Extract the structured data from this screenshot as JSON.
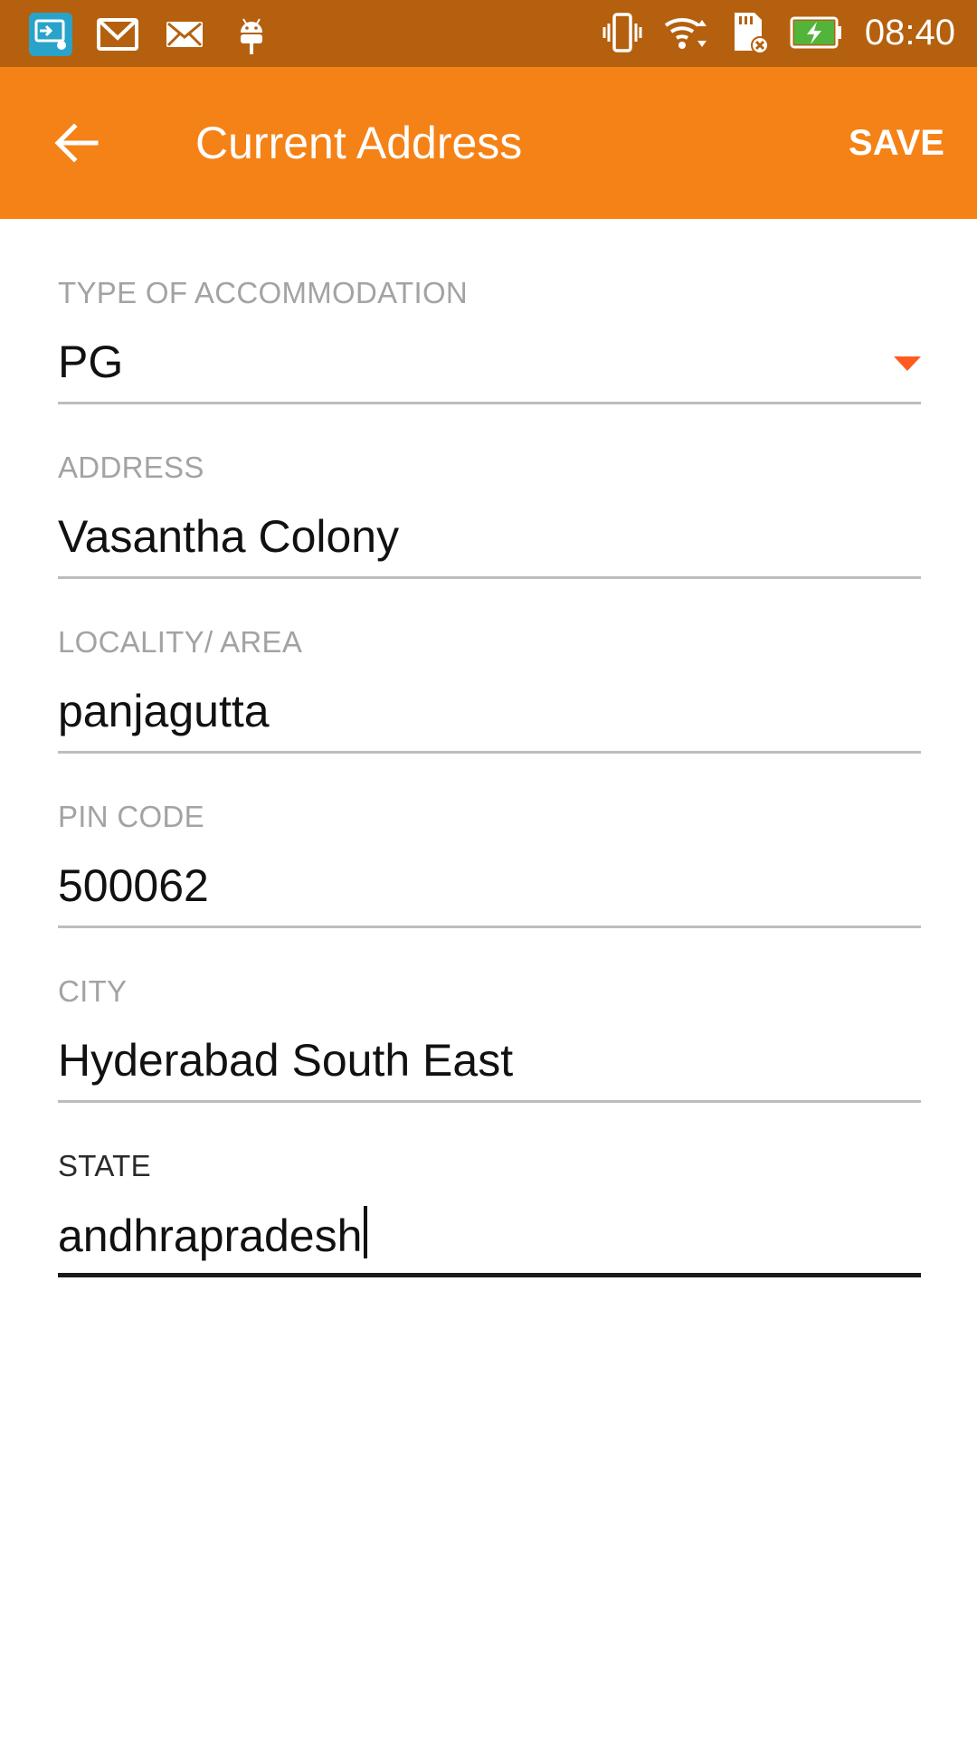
{
  "status_bar": {
    "time": "08:40",
    "icons": [
      "screen-mirror-icon",
      "gmail-icon",
      "mail-icon",
      "android-icon",
      "vibrate-icon",
      "wifi-icon",
      "sd-card-icon",
      "battery-charging-icon"
    ]
  },
  "app_bar": {
    "title": "Current Address",
    "save_label": "SAVE",
    "back_icon": "back-arrow-icon"
  },
  "form": {
    "accommodation": {
      "label": "TYPE OF ACCOMMODATION",
      "value": "PG"
    },
    "address": {
      "label": "ADDRESS",
      "value": "Vasantha Colony"
    },
    "locality": {
      "label": "LOCALITY/ AREA",
      "value": "panjagutta"
    },
    "pin_code": {
      "label": "PIN CODE",
      "value": "500062"
    },
    "city": {
      "label": "CITY",
      "value": "Hyderabad South East"
    },
    "state": {
      "label": "STATE",
      "value": "andhrapradesh"
    }
  },
  "colors": {
    "status_bar": "#b5600f",
    "app_bar": "#f58216",
    "dropdown_arrow": "#ff5a1f",
    "label": "#a3a3a3"
  }
}
